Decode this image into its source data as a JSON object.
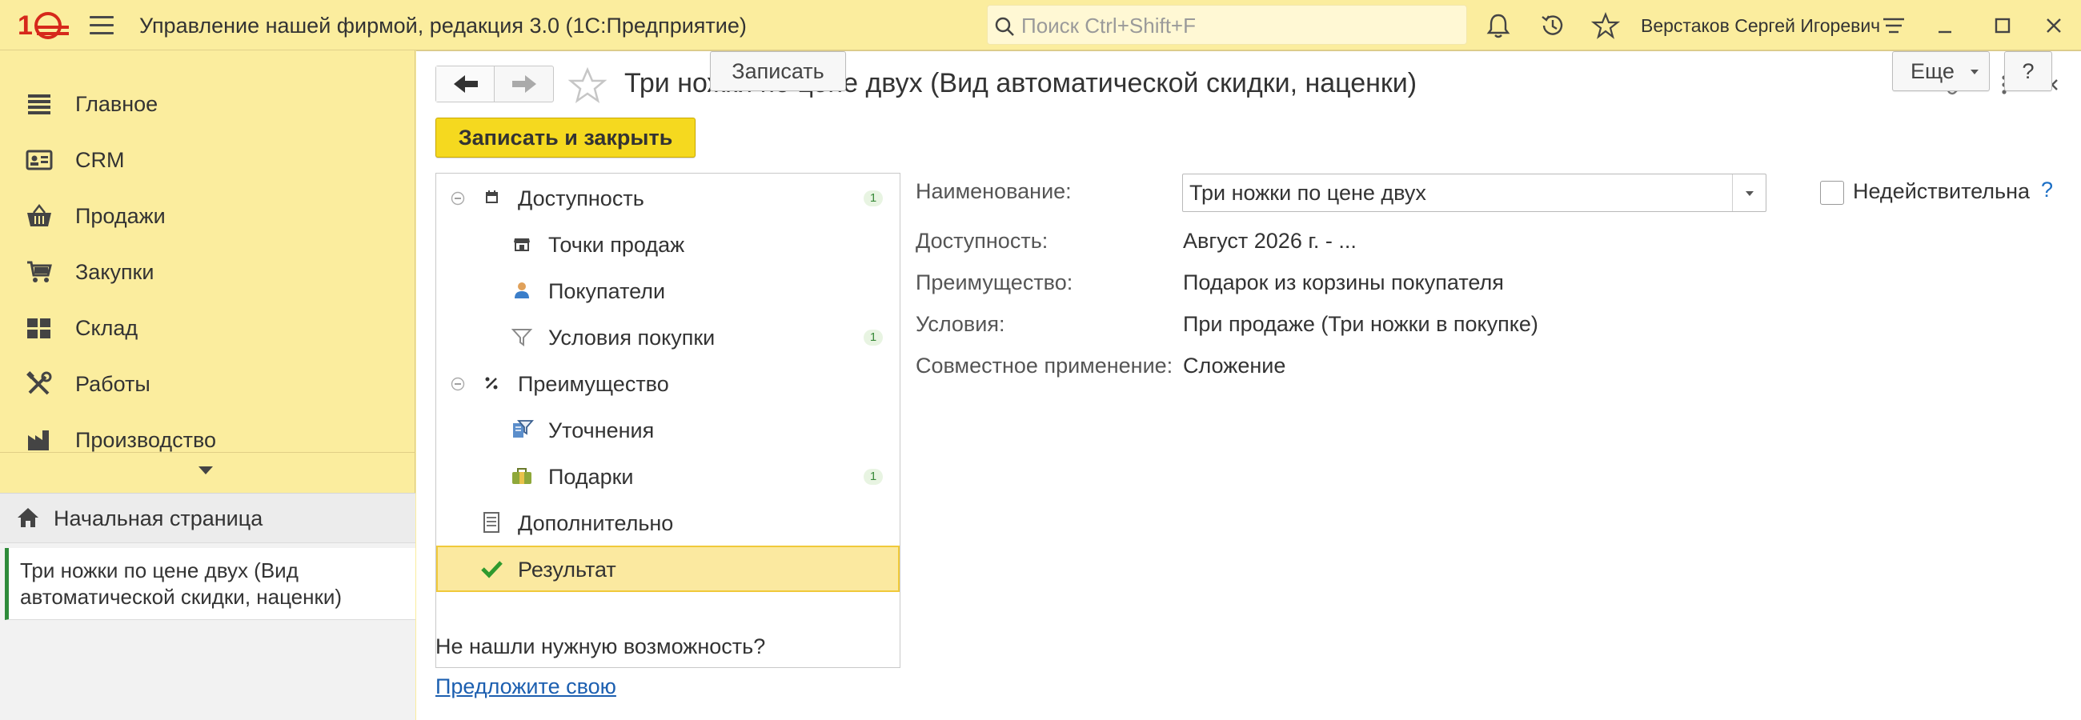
{
  "topbar": {
    "app_title": "Управление нашей фирмой, редакция 3.0  (1С:Предприятие)",
    "search_placeholder": "Поиск Ctrl+Shift+F",
    "user_name": "Верстаков Сергей Игоревич",
    "icons": [
      "logo-1c",
      "menu-icon",
      "search-icon",
      "bell-icon",
      "history-icon",
      "star-icon",
      "settings-lines-icon",
      "minimize-icon",
      "maximize-icon",
      "close-icon"
    ]
  },
  "sidebar": {
    "items": [
      {
        "label": "Главное",
        "icon": "list-icon"
      },
      {
        "label": "CRM",
        "icon": "crm-card-icon"
      },
      {
        "label": "Продажи",
        "icon": "basket-icon"
      },
      {
        "label": "Закупки",
        "icon": "cart-icon"
      },
      {
        "label": "Склад",
        "icon": "warehouse-grid-icon"
      },
      {
        "label": "Работы",
        "icon": "tools-icon"
      },
      {
        "label": "Производство",
        "icon": "factory-icon"
      }
    ],
    "home_label": "Начальная страница",
    "open_tab_label": "Три ножки по цене двух (Вид автоматической скидки, наценки)"
  },
  "form": {
    "title": "Три ножки по цене двух (Вид автоматической скидки, наценки)",
    "save_close_label": "Записать и закрыть",
    "save_label": "Записать",
    "more_label": "Еще",
    "help_label": "?",
    "tree": [
      {
        "label": "Доступность",
        "level": 0,
        "icon": "calendar-icon",
        "count": "1",
        "collapsible": true
      },
      {
        "label": "Точки продаж",
        "level": 1,
        "icon": "store-icon",
        "count": ""
      },
      {
        "label": "Покупатели",
        "level": 1,
        "icon": "person-icon",
        "count": ""
      },
      {
        "label": "Условия покупки",
        "level": 1,
        "icon": "filter-icon",
        "count": "1"
      },
      {
        "label": "Преимущество",
        "level": 0,
        "icon": "percent-icon",
        "count": "",
        "collapsible": true
      },
      {
        "label": "Уточнения",
        "level": 1,
        "icon": "filter-doc-icon",
        "count": ""
      },
      {
        "label": "Подарки",
        "level": 1,
        "icon": "gift-bag-icon",
        "count": "1"
      },
      {
        "label": "Дополнительно",
        "level": 0,
        "icon": "doc-list-icon",
        "count": ""
      },
      {
        "label": "Результат",
        "level": 0,
        "icon": "checkmark-icon",
        "count": "",
        "selected": true
      }
    ],
    "hint": "Не нашли нужную возможность?",
    "hint_link": "Предложите свою",
    "fields": {
      "name_label": "Наименование:",
      "name_value": "Три ножки по цене двух",
      "inactive_label": "Недействительна",
      "help_q": "?",
      "availability_label": "Доступность:",
      "availability_value": "Август 2026 г. - ...",
      "advantage_label": "Преимущество:",
      "advantage_value": "Подарок из корзины покупателя",
      "conditions_label": "Условия:",
      "conditions_value": "При продаже (Три ножки в покупке)",
      "joint_label": "Совместное применение:",
      "joint_value": "Сложение"
    }
  },
  "colors": {
    "panel_yellow": "#fbed9e",
    "primary_button": "#f5d91f",
    "selected_row": "#fbe9a0",
    "link": "#1c5fb0",
    "accent_green": "#2e8b3a",
    "logo_red": "#d6281b"
  }
}
